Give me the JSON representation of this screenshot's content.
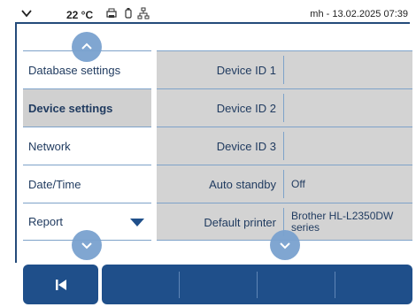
{
  "status_bar": {
    "temperature": "22 °C",
    "datetime": "mh - 13.02.2025 07:39",
    "icons": [
      "chevron-down-icon",
      "printer-icon",
      "usb-icon",
      "network-icon"
    ]
  },
  "menu": {
    "items": [
      {
        "label": "Database settings"
      },
      {
        "label": "Device settings"
      },
      {
        "label": "Network"
      },
      {
        "label": "Date/Time"
      },
      {
        "label": "Report"
      }
    ]
  },
  "settings": [
    {
      "label": "Device ID 1",
      "value": ""
    },
    {
      "label": "Device ID 2",
      "value": ""
    },
    {
      "label": "Device ID 3",
      "value": ""
    },
    {
      "label": "Auto standby",
      "value": "Off"
    },
    {
      "label": "Default printer",
      "value": "Brother HL-L2350DW series"
    }
  ],
  "colors": {
    "accent": "#1f4f8a",
    "scroll_circle": "#7aa2cf",
    "table_bg": "#d3d3d3",
    "active_menu_bg": "#d0d0d0"
  }
}
